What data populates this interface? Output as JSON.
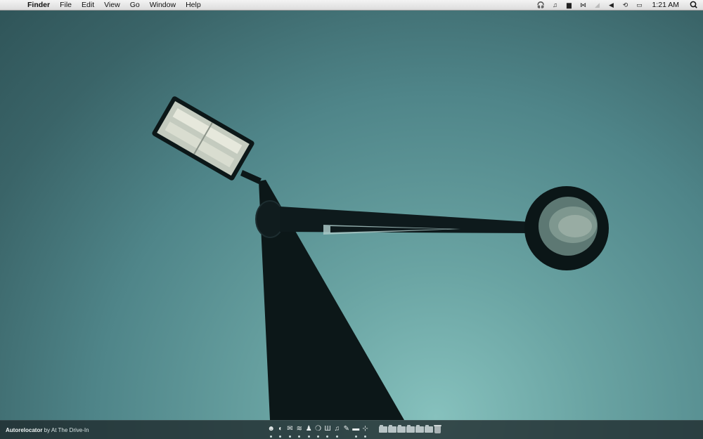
{
  "menubar": {
    "apple_icon": "",
    "items": [
      "Finder",
      "File",
      "Edit",
      "View",
      "Go",
      "Window",
      "Help"
    ],
    "status_icons": [
      {
        "name": "headphones-icon",
        "glyph": "🎧"
      },
      {
        "name": "music-note-icon",
        "glyph": "♫"
      },
      {
        "name": "chat-bubble-icon",
        "glyph": "▆"
      },
      {
        "name": "bow-tie-icon",
        "glyph": "⋈"
      },
      {
        "name": "wifi-dim-icon",
        "glyph": "◢"
      },
      {
        "name": "volume-icon",
        "glyph": "◀"
      },
      {
        "name": "time-machine-icon",
        "glyph": "⟲"
      },
      {
        "name": "battery-icon",
        "glyph": "▭"
      }
    ],
    "clock": "1:21 AM"
  },
  "dockbar": {
    "credit_app": "Autorelocator",
    "credit_rest": " by At The Drive-In",
    "apps": [
      {
        "name": "finder-icon",
        "glyph": "☻"
      },
      {
        "name": "safari-icon",
        "glyph": "◐"
      },
      {
        "name": "mail-icon",
        "glyph": "✉"
      },
      {
        "name": "rss-icon",
        "glyph": "≋"
      },
      {
        "name": "contacts-icon",
        "glyph": "♟"
      },
      {
        "name": "chat-icon",
        "glyph": "❍"
      },
      {
        "name": "media-icon",
        "glyph": "Ш"
      },
      {
        "name": "itunes-icon",
        "glyph": "♫"
      },
      {
        "name": "tools-icon",
        "glyph": "✎"
      },
      {
        "name": "terminal-icon",
        "glyph": "▬"
      },
      {
        "name": "grab-icon",
        "glyph": "⊹"
      }
    ],
    "folder_count": 6
  },
  "colors": {
    "sky_bright": "#86c1bd",
    "sky_dark": "#2f5458",
    "silhouette": "#0c1718"
  }
}
